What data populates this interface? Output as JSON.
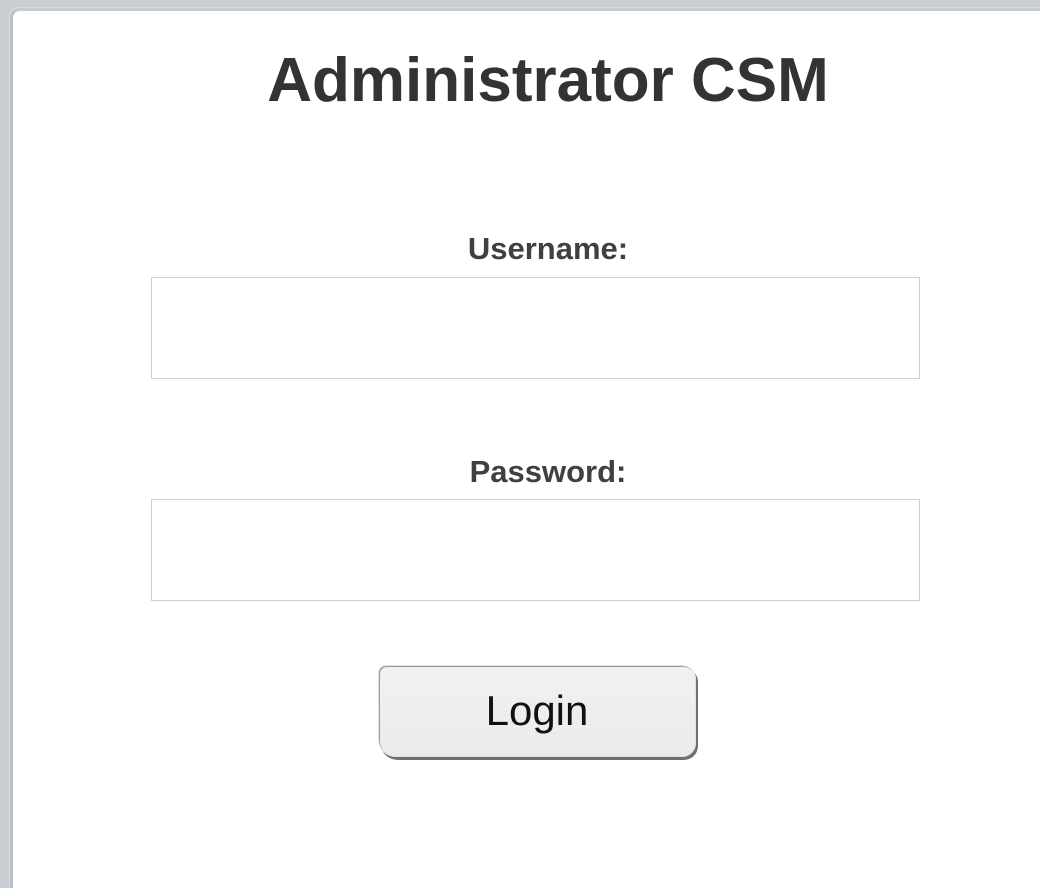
{
  "page": {
    "title": "Administrator CSM"
  },
  "form": {
    "username_label": "Username:",
    "username_value": "",
    "password_label": "Password:",
    "password_value": "",
    "login_label": "Login"
  }
}
